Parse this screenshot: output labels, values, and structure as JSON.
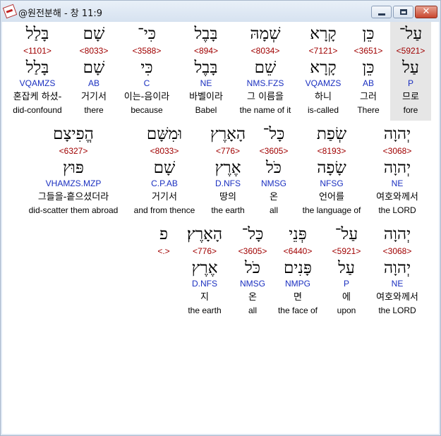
{
  "window": {
    "title": "@원전분해 - 창 11:9",
    "close_glyph": "✕"
  },
  "rows": [
    {
      "words": [
        {
          "hebrew": "עַל־",
          "strong": "<5921>",
          "lemma": "עַל",
          "parse": "P",
          "korean": "므로",
          "english": "fore",
          "highlighted": true
        },
        {
          "hebrew": "כֵּן",
          "strong": "<3651>",
          "lemma": "כֵּן",
          "parse": "AB",
          "korean": "그러",
          "english": "There"
        },
        {
          "hebrew": "קָרָא",
          "strong": "<7121>",
          "lemma": "קָרָא",
          "parse": "VQAMZS",
          "korean": "하니",
          "english": "is-called"
        },
        {
          "hebrew": "שְׁמָהּ",
          "strong": "<8034>",
          "lemma": "שֵׁם",
          "parse": "NMS.FZS",
          "korean": "그 이름을",
          "english": "the name of it"
        },
        {
          "hebrew": "בָּבֶל",
          "strong": "<894>",
          "lemma": "בָּבֶל",
          "parse": "NE",
          "korean": "바벨이라",
          "english": "Babel"
        },
        {
          "hebrew": "כִּי־",
          "strong": "<3588>",
          "lemma": "כִּי",
          "parse": "C",
          "korean": "이는-음이라",
          "english": "because"
        },
        {
          "hebrew": "שָׁם",
          "strong": "<8033>",
          "lemma": "שָׁם",
          "parse": "AB",
          "korean": "거기서",
          "english": "there"
        },
        {
          "hebrew": "בָּלַל",
          "strong": "<1101>",
          "lemma": "בָּלַל",
          "parse": "VQAMZS",
          "korean": "혼잡케 하셨-",
          "english": "did-confound"
        }
      ]
    },
    {
      "words": [
        {
          "hebrew": "יְהוָה",
          "strong": "<3068>",
          "lemma": "יְהוָה",
          "parse": "NE",
          "korean": "여호와께서",
          "english": "the LORD"
        },
        {
          "hebrew": "שְׂפַת",
          "strong": "<8193>",
          "lemma": "שָׂפָה",
          "parse": "NFSG",
          "korean": "언어를",
          "english": "the language of"
        },
        {
          "hebrew": "כָּל־",
          "strong": "<3605>",
          "lemma": "כֹּל",
          "parse": "NMSG",
          "korean": "온",
          "english": "all"
        },
        {
          "hebrew": "הָאָרֶץ",
          "strong": "<776>",
          "lemma": "אֶרֶץ",
          "parse": "D.NFS",
          "korean": "땅의",
          "english": "the earth"
        },
        {
          "hebrew": "וּמִשָּׁם",
          "strong": "<8033>",
          "lemma": "שָׁם",
          "parse": "C.P.AB",
          "korean": "거기서",
          "english": "and from thence"
        },
        {
          "hebrew": "הֱפִיצָם",
          "strong": "<6327>",
          "lemma": "פּוּץ",
          "parse": "VHAMZS.MZP",
          "korean": "그들을-흩으셨더라",
          "english": "did-scatter them abroad"
        }
      ]
    },
    {
      "words": [
        {
          "hebrew": "יְהוָה",
          "strong": "<3068>",
          "lemma": "יְהוָה",
          "parse": "NE",
          "korean": "여호와께서",
          "english": "the LORD"
        },
        {
          "hebrew": "עַל־",
          "strong": "<5921>",
          "lemma": "עַל",
          "parse": "P",
          "korean": "에",
          "english": "upon"
        },
        {
          "hebrew": "פְּנֵי",
          "strong": "<6440>",
          "lemma": "פָּנִים",
          "parse": "NMPG",
          "korean": "면",
          "english": "the face of"
        },
        {
          "hebrew": "כָּל־",
          "strong": "<3605>",
          "lemma": "כֹּל",
          "parse": "NMSG",
          "korean": "온",
          "english": "all"
        },
        {
          "hebrew": "הָאָרֶץ׃",
          "strong": "<776>",
          "lemma": "אֶרֶץ",
          "parse": "D.NFS",
          "korean": "지",
          "english": "the earth"
        },
        {
          "hebrew": "פ",
          "strong": "<.>",
          "lemma": "",
          "parse": "",
          "korean": "",
          "english": ""
        }
      ]
    }
  ]
}
